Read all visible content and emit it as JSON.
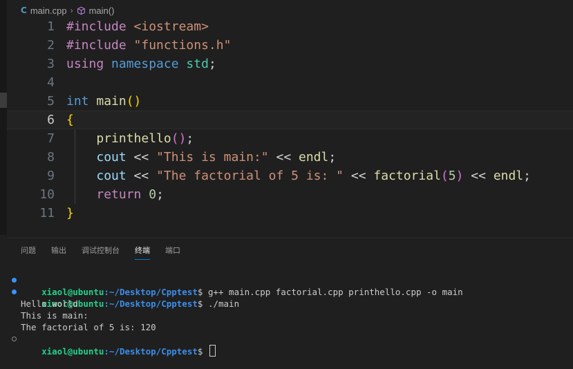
{
  "breadcrumb": {
    "file_icon": "C",
    "file": "main.cpp",
    "separator": "›",
    "symbol": "main()"
  },
  "editor": {
    "line_numbers": [
      "1",
      "2",
      "3",
      "4",
      "5",
      "6",
      "7",
      "8",
      "9",
      "10",
      "11"
    ],
    "current_line": "6",
    "lines": [
      [
        [
          "#include",
          "dir"
        ],
        [
          " ",
          "pun"
        ],
        [
          "<iostream>",
          "str"
        ]
      ],
      [
        [
          "#include",
          "dir"
        ],
        [
          " ",
          "pun"
        ],
        [
          "\"functions.h\"",
          "str"
        ]
      ],
      [
        [
          "using",
          "ctl"
        ],
        [
          " ",
          "pun"
        ],
        [
          "namespace",
          "kw"
        ],
        [
          " ",
          "pun"
        ],
        [
          "std",
          "ns"
        ],
        [
          ";",
          "pun"
        ]
      ],
      [],
      [
        [
          "int",
          "kw"
        ],
        [
          " ",
          "pun"
        ],
        [
          "main",
          "fn"
        ],
        [
          "()",
          "br1"
        ]
      ],
      [
        [
          "{",
          "br1"
        ]
      ],
      [
        [
          "    ",
          "pun"
        ],
        [
          "printhello",
          "fn"
        ],
        [
          "()",
          "br2"
        ],
        [
          ";",
          "pun"
        ]
      ],
      [
        [
          "    ",
          "pun"
        ],
        [
          "cout",
          "var"
        ],
        [
          " << ",
          "pun"
        ],
        [
          "\"This is main:\"",
          "str"
        ],
        [
          " << ",
          "pun"
        ],
        [
          "endl",
          "fn"
        ],
        [
          ";",
          "pun"
        ]
      ],
      [
        [
          "    ",
          "pun"
        ],
        [
          "cout",
          "var"
        ],
        [
          " << ",
          "pun"
        ],
        [
          "\"The factorial of 5 is: \"",
          "str"
        ],
        [
          " << ",
          "pun"
        ],
        [
          "factorial",
          "fn"
        ],
        [
          "(",
          "br2"
        ],
        [
          "5",
          "num"
        ],
        [
          ")",
          "br2"
        ],
        [
          " << ",
          "pun"
        ],
        [
          "endl",
          "fn"
        ],
        [
          ";",
          "pun"
        ]
      ],
      [
        [
          "    ",
          "pun"
        ],
        [
          "return",
          "ctl"
        ],
        [
          " ",
          "pun"
        ],
        [
          "0",
          "num"
        ],
        [
          ";",
          "pun"
        ]
      ],
      [
        [
          "}",
          "br1"
        ]
      ]
    ]
  },
  "panel": {
    "tabs": [
      "问题",
      "输出",
      "调试控制台",
      "终端",
      "端口"
    ],
    "active_tab": "终端"
  },
  "terminal": {
    "user_host": "xiaol@ubuntu",
    "path": ":~/Desktop/Cpptest",
    "prompt_symbol": "$ ",
    "cmd1": "g++ main.cpp factorial.cpp printhello.cpp -o main",
    "cmd2": "./main",
    "output": [
      "Hello world",
      "This is main:",
      "The factorial of 5 is: 120"
    ]
  },
  "colors": {
    "background": "#1f1f1f",
    "accent": "#0078d4",
    "prompt_user": "#23d18b",
    "prompt_path": "#3b8eea"
  }
}
